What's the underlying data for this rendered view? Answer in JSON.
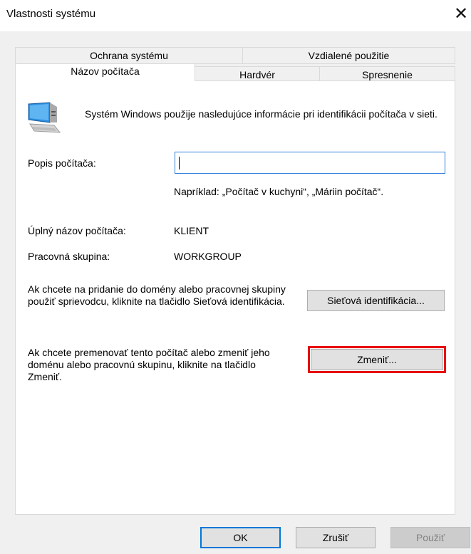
{
  "window": {
    "title": "Vlastnosti systému",
    "close_glyph": "✕"
  },
  "tabs": {
    "back_row": [
      "Ochrana systému",
      "Vzdialené použitie"
    ],
    "front_row": [
      "Názov počítača",
      "Hardvér",
      "Spresnenie"
    ],
    "active": "Názov počítača"
  },
  "panel": {
    "icon": "computer-icon",
    "intro": "Systém Windows použije nasledujúce informácie pri identifikácii počítača v sieti.",
    "description_label": "Popis počítača:",
    "description_value": "",
    "example": "Napríklad: „Počítač v kuchyni“, „Máriin počítač“.",
    "full_name_label": "Úplný názov počítača:",
    "full_name_value": "KLIENT",
    "workgroup_label": "Pracovná skupina:",
    "workgroup_value": "WORKGROUP",
    "network_id_text": "Ak chcete na pridanie do domény alebo pracovnej skupiny použiť sprievodcu, kliknite na tlačidlo Sieťová identifikácia.",
    "network_id_button": "Sieťová identifikácia...",
    "change_text": "Ak chcete premenovať tento počítač alebo zmeniť jeho doménu alebo pracovnú skupinu, kliknite na tlačidlo Zmeniť.",
    "change_button": "Zmeniť..."
  },
  "buttons": {
    "ok": "OK",
    "cancel": "Zrušiť",
    "apply": "Použiť"
  },
  "colors": {
    "highlight": "#e8000b",
    "focus_blue": "#0078d7"
  }
}
